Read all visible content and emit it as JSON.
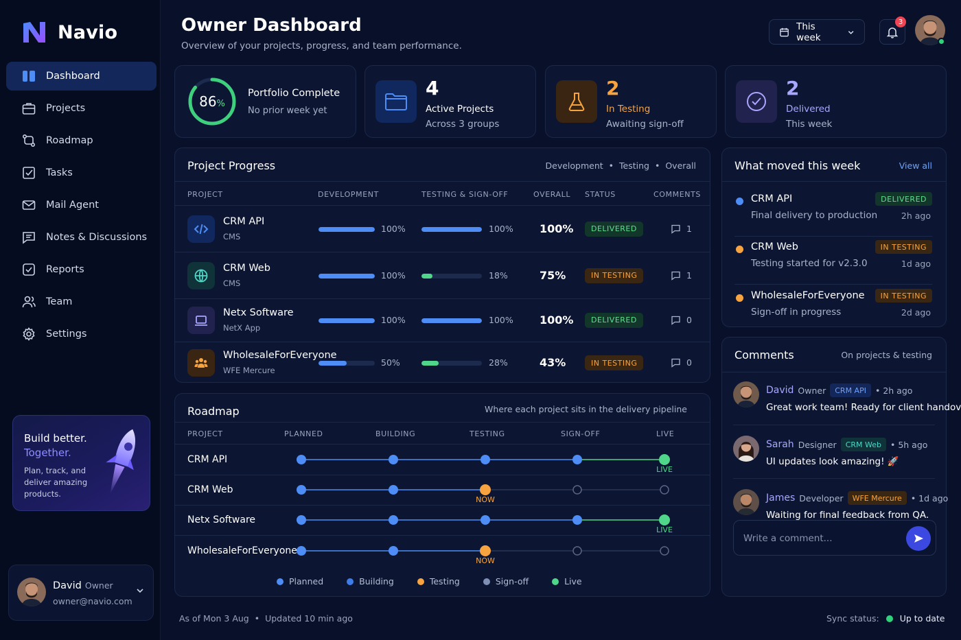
{
  "brand": {
    "name": "Navio"
  },
  "sidebar": {
    "items": [
      {
        "label": "Dashboard",
        "icon": "dashboard-icon"
      },
      {
        "label": "Projects",
        "icon": "briefcase-icon"
      },
      {
        "label": "Roadmap",
        "icon": "roadmap-icon"
      },
      {
        "label": "Tasks",
        "icon": "checkbox-icon"
      },
      {
        "label": "Mail Agent",
        "icon": "mail-icon"
      },
      {
        "label": "Notes & Discussions",
        "icon": "chat-icon"
      },
      {
        "label": "Reports",
        "icon": "report-icon"
      },
      {
        "label": "Team",
        "icon": "team-icon"
      },
      {
        "label": "Settings",
        "icon": "gear-icon"
      }
    ],
    "promo": {
      "title": "Build better.",
      "subtitle": "Together.",
      "text": "Plan, track, and deliver amazing products."
    },
    "user": {
      "name": "David",
      "role": "Owner",
      "email": "owner@navio.com"
    }
  },
  "header": {
    "title": "Owner Dashboard",
    "subtitle": "Overview of your projects, progress, and team performance.",
    "range": "This week",
    "notifications": "3"
  },
  "kpis": {
    "portfolio": {
      "value": "86",
      "unit": "%",
      "fraction": 0.86,
      "label": "Portfolio Complete",
      "sub": "No prior week yet"
    },
    "active": {
      "value": "4",
      "label": "Active Projects",
      "sub": "Across 3 groups"
    },
    "testing": {
      "value": "2",
      "label": "In Testing",
      "sub": "Awaiting sign-off"
    },
    "delivered": {
      "value": "2",
      "label": "Delivered",
      "sub": "This week"
    }
  },
  "progress": {
    "title": "Project Progress",
    "legend": {
      "dev": "Development",
      "test": "Testing",
      "overall": "Overall",
      "sep": "•"
    },
    "columns": {
      "project": "PROJECT",
      "development": "DEVELOPMENT",
      "testing": "TESTING & SIGN-OFF",
      "overall": "OVERALL",
      "status": "STATUS",
      "comments": "COMMENTS"
    },
    "rows": [
      {
        "name": "CRM API",
        "sub": "CMS",
        "dev": 1.0,
        "dev_label": "100%",
        "test": 1.0,
        "test_label": "100%",
        "overall": "100%",
        "status": "DELIVERED",
        "comments": "1"
      },
      {
        "name": "CRM Web",
        "sub": "CMS",
        "dev": 1.0,
        "dev_label": "100%",
        "test": 0.18,
        "test_label": "18%",
        "overall": "75%",
        "status": "IN TESTING",
        "comments": "1"
      },
      {
        "name": "Netx Software",
        "sub": "NetX App",
        "dev": 1.0,
        "dev_label": "100%",
        "test": 1.0,
        "test_label": "100%",
        "overall": "100%",
        "status": "DELIVERED",
        "comments": "0"
      },
      {
        "name": "WholesaleForEveryone",
        "sub": "WFE Mercure",
        "dev": 0.5,
        "dev_label": "50%",
        "test": 0.28,
        "test_label": "28%",
        "overall": "43%",
        "status": "IN TESTING",
        "comments": "0"
      }
    ]
  },
  "roadmap": {
    "title": "Roadmap",
    "subtitle": "Where each project sits in the delivery pipeline",
    "columns": {
      "project": "PROJECT",
      "planned": "PLANNED",
      "building": "BUILDING",
      "testing": "TESTING",
      "signoff": "SIGN-OFF",
      "live": "LIVE"
    },
    "rows": [
      {
        "name": "CRM API",
        "stage": 4,
        "marker": "LIVE"
      },
      {
        "name": "CRM Web",
        "stage": 2,
        "marker": "NOW"
      },
      {
        "name": "Netx Software",
        "stage": 4,
        "marker": "LIVE"
      },
      {
        "name": "WholesaleForEveryone",
        "stage": 2,
        "marker": "NOW"
      }
    ],
    "legend": {
      "planned": "Planned",
      "building": "Building",
      "testing": "Testing",
      "signoff": "Sign-off",
      "live": "Live"
    }
  },
  "moved": {
    "title": "What moved this week",
    "view_all": "View all",
    "items": [
      {
        "name": "CRM API",
        "desc": "Final delivery to production",
        "badge": "DELIVERED",
        "time": "2h ago"
      },
      {
        "name": "CRM Web",
        "desc": "Testing started for v2.3.0",
        "badge": "IN TESTING",
        "time": "1d ago"
      },
      {
        "name": "WholesaleForEveryone",
        "desc": "Sign-off in progress",
        "badge": "IN TESTING",
        "time": "2d ago"
      }
    ]
  },
  "comments": {
    "title": "Comments",
    "subtitle": "On projects & testing",
    "items": [
      {
        "name": "David",
        "role": "Owner",
        "tag": "CRM API",
        "time": "• 2h ago",
        "text": "Great work team! Ready for client handover."
      },
      {
        "name": "Sarah",
        "role": "Designer",
        "tag": "CRM Web",
        "time": "• 5h ago",
        "text": "UI updates look amazing! 🚀"
      },
      {
        "name": "James",
        "role": "Developer",
        "tag": "WFE Mercure",
        "time": "• 1d ago",
        "text": "Waiting for final feedback from QA."
      }
    ],
    "placeholder": "Write a comment..."
  },
  "footer": {
    "asof": "As of Mon 3 Aug",
    "sep": "•",
    "updated": "Updated 10 min ago",
    "sync_label": "Sync status:",
    "sync_value": "Up to date"
  },
  "colors": {
    "accent": "#4d8df5",
    "green": "#4fd68a",
    "orange": "#f7a440",
    "purple": "#8f8dff"
  }
}
